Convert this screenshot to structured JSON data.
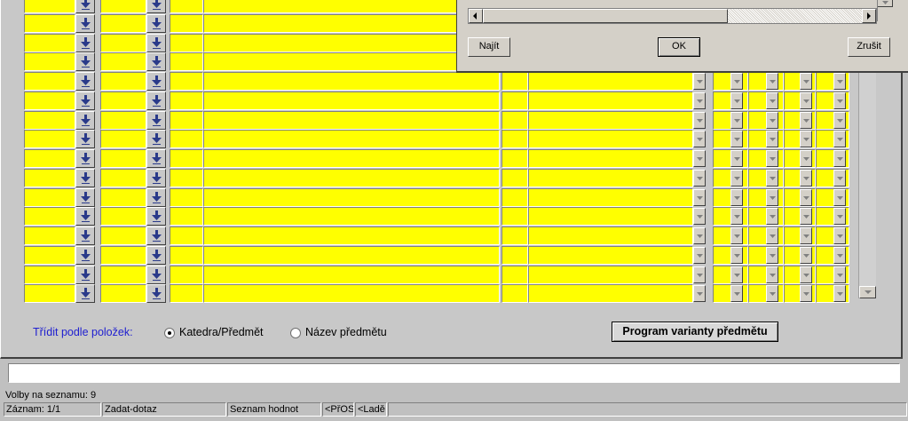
{
  "sort": {
    "label": "Třídit podle položek:",
    "options": [
      {
        "label": "Katedra/Předmět",
        "selected": true
      },
      {
        "label": "Název předmětu",
        "selected": false
      }
    ]
  },
  "buttons": {
    "program_variant": "Program varianty předmětu"
  },
  "dialog": {
    "find_label": "Najít",
    "ok_label": "OK",
    "cancel_label": "Zrušit"
  },
  "status": {
    "list_choices": "Volby na seznamu: 9",
    "record": "Záznam: 1/1",
    "mode": "Zadat-dotaz",
    "list_values": "Seznam hodnot",
    "pros": "<PřOS",
    "debug": "<Ladě"
  },
  "grid": {
    "row_count": 16,
    "row_color": "#ffff00"
  },
  "colors": {
    "field_bg": "#ffff00",
    "accent_text": "#2020d0",
    "panel_bg": "#c8c8c8"
  }
}
